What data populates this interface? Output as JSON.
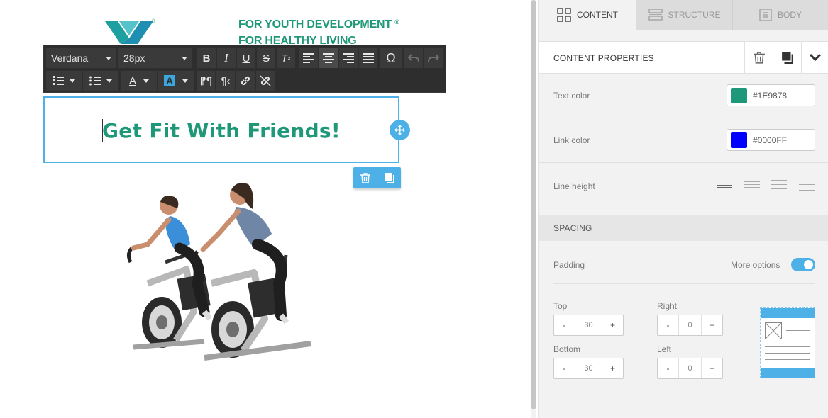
{
  "canvas": {
    "tagline": [
      "FOR YOUTH DEVELOPMENT",
      "FOR HEALTHY LIVING"
    ],
    "tagline_mark": "®",
    "logo_mark": "®",
    "headline": "Get Fit With Friends!",
    "headline_color": "#1E9878",
    "toolbar": {
      "font_family": "Verdana",
      "font_size": "28px",
      "buttons_row1": [
        "bold",
        "italic",
        "underline",
        "strikethrough",
        "clear-format",
        "align-left",
        "align-center",
        "align-right",
        "align-justify",
        "special-character",
        "undo",
        "redo"
      ],
      "buttons_row2": [
        "numbered-list",
        "bulleted-list",
        "text-color",
        "background-color",
        "ltr",
        "rtl",
        "link",
        "unlink"
      ],
      "omega_glyph": "Ω",
      "text_color_glyph": "A",
      "bg_color_glyph": "A"
    }
  },
  "panel": {
    "tabs": [
      {
        "label": "CONTENT",
        "icon": "grid-icon",
        "active": true
      },
      {
        "label": "STRUCTURE",
        "icon": "rows-icon",
        "active": false
      },
      {
        "label": "BODY",
        "icon": "document-icon",
        "active": false
      }
    ],
    "section_title": "CONTENT PROPERTIES",
    "text_color": {
      "label": "Text color",
      "value": "#1E9878"
    },
    "link_color": {
      "label": "Link color",
      "value": "#0000FF"
    },
    "line_height": {
      "label": "Line height"
    },
    "spacing_title": "SPACING",
    "padding": {
      "label": "Padding",
      "more_options_label": "More options",
      "more_options_on": true,
      "top": {
        "label": "Top",
        "value": "30"
      },
      "right": {
        "label": "Right",
        "value": "0"
      },
      "bottom": {
        "label": "Bottom",
        "value": "30"
      },
      "left": {
        "label": "Left",
        "value": "0"
      },
      "minus": "-",
      "plus": "+"
    }
  },
  "colors": {
    "accent": "#4db1e8",
    "brand_green": "#1e9878",
    "link_blue": "#0000ff"
  }
}
